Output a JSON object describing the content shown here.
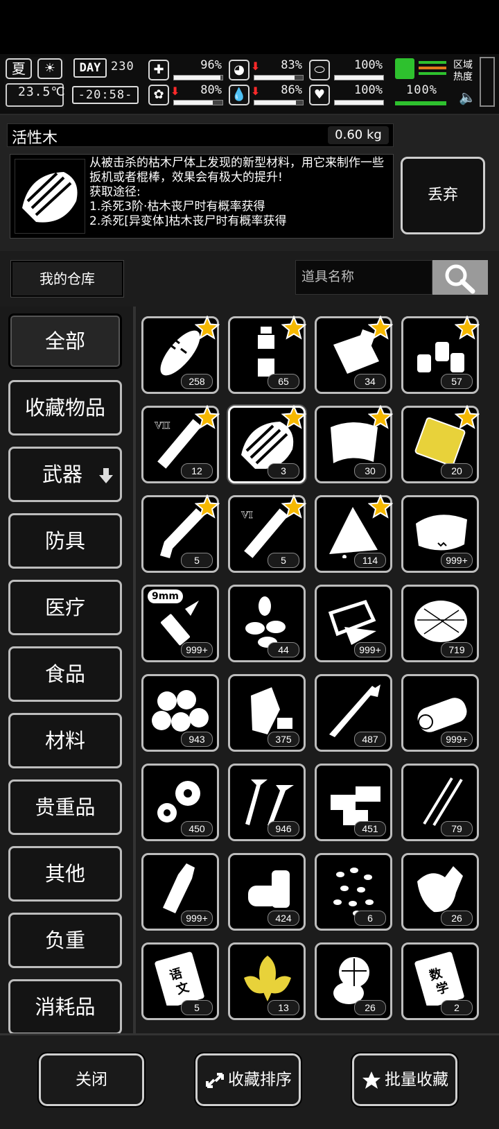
{
  "status": {
    "season": "夏",
    "temperature": "23.5℃",
    "day_label": "DAY",
    "day": "230",
    "time": "-20:58-",
    "stats": [
      {
        "name": "health",
        "value": "96%",
        "fill": 0.96,
        "down": false
      },
      {
        "name": "hunger",
        "value": "83%",
        "fill": 0.83,
        "down": true
      },
      {
        "name": "stamina",
        "value": "100%",
        "fill": 1.0,
        "down": false
      },
      {
        "name": "mental",
        "value": "80%",
        "fill": 0.8,
        "down": true
      },
      {
        "name": "thirst",
        "value": "86%",
        "fill": 0.86,
        "down": true
      },
      {
        "name": "mood",
        "value": "100%",
        "fill": 1.0,
        "down": false
      }
    ],
    "leg_value": "100%",
    "region_label": "区域热度"
  },
  "item": {
    "name": "活性木",
    "weight": "0.60 kg",
    "description": "从被击杀的枯木尸体上发现的新型材料，用它来制作一些扳机或者棍棒，效果会有极大的提升!\n获取途径:\n1.杀死3阶·枯木丧尸时有概率获得\n2.杀死[异变体]枯木丧尸时有概率获得",
    "discard_label": "丢弃"
  },
  "warehouse": {
    "label": "我的仓库",
    "search_placeholder": "道具名称"
  },
  "categories": [
    "全部",
    "收藏物品",
    "武器",
    "防具",
    "医疗",
    "食品",
    "材料",
    "贵重品",
    "其他",
    "负重",
    "消耗品"
  ],
  "items": [
    {
      "icon": "bread-icon",
      "count": "258",
      "fav": true
    },
    {
      "icon": "water-bottle-icon",
      "count": "65",
      "fav": true
    },
    {
      "icon": "paper-roll-icon",
      "count": "34",
      "fav": true
    },
    {
      "icon": "spice-jars-icon",
      "count": "57",
      "fav": true
    },
    {
      "icon": "syringe-vii-icon",
      "count": "12",
      "fav": true,
      "tag": "VII"
    },
    {
      "icon": "active-wood-icon",
      "count": "3",
      "fav": true,
      "selected": true
    },
    {
      "icon": "cloth-icon",
      "count": "30",
      "fav": true
    },
    {
      "icon": "gold-plate-icon",
      "count": "20",
      "fav": true
    },
    {
      "icon": "wood-branch-icon",
      "count": "5",
      "fav": true
    },
    {
      "icon": "syringe-vi-icon",
      "count": "5",
      "fav": true,
      "tag": "VI"
    },
    {
      "icon": "wax-icon",
      "count": "114",
      "fav": true
    },
    {
      "icon": "leather-icon",
      "count": "999+",
      "fav": false
    },
    {
      "icon": "bullet-9mm-icon",
      "count": "999+",
      "fav": false,
      "tag": "9mm"
    },
    {
      "icon": "seeds-icon",
      "count": "44",
      "fav": false
    },
    {
      "icon": "scrap-metal-icon",
      "count": "999+",
      "fav": false
    },
    {
      "icon": "fiber-icon",
      "count": "719",
      "fav": false
    },
    {
      "icon": "cotton-balls-icon",
      "count": "943",
      "fav": false
    },
    {
      "icon": "plastic-bottle-icon",
      "count": "375",
      "fav": false
    },
    {
      "icon": "scallion-icon",
      "count": "487",
      "fav": false
    },
    {
      "icon": "log-icon",
      "count": "999+",
      "fav": false
    },
    {
      "icon": "gears-icon",
      "count": "450",
      "fav": false
    },
    {
      "icon": "screws-icon",
      "count": "946",
      "fav": false
    },
    {
      "icon": "bricks-icon",
      "count": "451",
      "fav": false
    },
    {
      "icon": "needles-icon",
      "count": "79",
      "fav": false
    },
    {
      "icon": "glass-bottle-icon",
      "count": "999+",
      "fav": false
    },
    {
      "icon": "cans-icon",
      "count": "424",
      "fav": false
    },
    {
      "icon": "beans-icon",
      "count": "6",
      "fav": false
    },
    {
      "icon": "ginger-icon",
      "count": "26",
      "fav": false
    },
    {
      "icon": "chinese-book-icon",
      "count": "5",
      "fav": false
    },
    {
      "icon": "tobacco-leaves-icon",
      "count": "13",
      "fav": false
    },
    {
      "icon": "cabbage-icon",
      "count": "26",
      "fav": false
    },
    {
      "icon": "math-book-icon",
      "count": "2",
      "fav": false
    }
  ],
  "book_labels": {
    "chinese": "语文",
    "math": "数学"
  },
  "bottom": {
    "close_label": "关闭",
    "sort_label": "收藏排序",
    "batch_label": "批量收藏"
  },
  "colors": {
    "star": "#f5b800",
    "gold": "#e8d23a",
    "background": "#1c1c1c"
  }
}
